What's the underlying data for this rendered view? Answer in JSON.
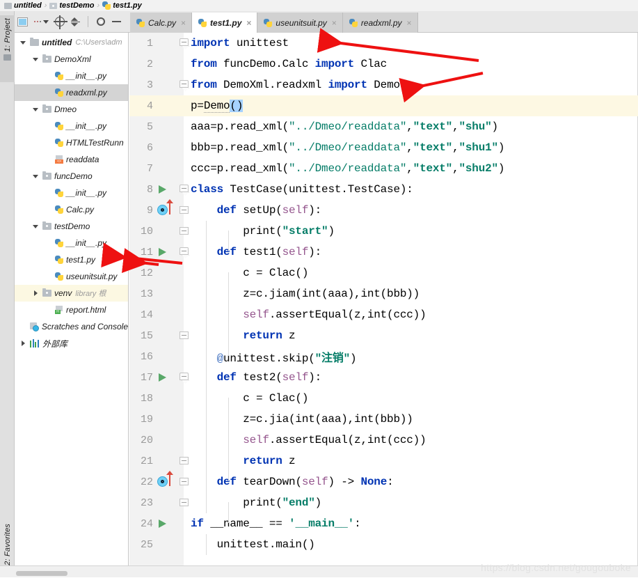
{
  "breadcrumb": {
    "items": [
      {
        "label": "untitled",
        "icon": "folder-icon"
      },
      {
        "label": "testDemo",
        "icon": "module-icon"
      },
      {
        "label": "test1.py",
        "icon": "python-file-icon"
      }
    ],
    "separator": "›"
  },
  "toolbar": {
    "project_view_label": "project-view",
    "dots_label": "show-options",
    "locate_label": "select-opened-file",
    "collapse_label": "collapse-all",
    "settings_label": "settings",
    "hide_label": "hide"
  },
  "stripes": {
    "project_label": "1: Project",
    "favorites_label": "2: Favorites"
  },
  "tabs": [
    {
      "label": "Calc.py",
      "active": false,
      "close": "×"
    },
    {
      "label": "test1.py",
      "active": true,
      "close": "×"
    },
    {
      "label": "useunitsuit.py",
      "active": false,
      "close": "×"
    },
    {
      "label": "readxml.py",
      "active": false,
      "close": "×"
    }
  ],
  "project_tree": [
    {
      "indent": 0,
      "arrow": "down",
      "icon": "folder-icon",
      "label": "untitled",
      "bold": true,
      "sub": "C:\\Users\\adm",
      "state": "normal"
    },
    {
      "indent": 1,
      "arrow": "down",
      "icon": "package-icon",
      "label": "DemoXml",
      "bold": false,
      "sub": "",
      "state": "normal"
    },
    {
      "indent": 2,
      "arrow": "none",
      "icon": "python-file-icon",
      "label": "__init__.py",
      "bold": false,
      "sub": "",
      "state": "normal"
    },
    {
      "indent": 2,
      "arrow": "none",
      "icon": "python-file-icon",
      "label": "readxml.py",
      "bold": false,
      "sub": "",
      "state": "selected"
    },
    {
      "indent": 1,
      "arrow": "down",
      "icon": "package-icon",
      "label": "Dmeo",
      "bold": false,
      "sub": "",
      "state": "normal"
    },
    {
      "indent": 2,
      "arrow": "none",
      "icon": "python-file-icon",
      "label": "__init__.py",
      "bold": false,
      "sub": "",
      "state": "normal"
    },
    {
      "indent": 2,
      "arrow": "none",
      "icon": "python-file-icon",
      "label": "HTMLTestRunn",
      "bold": false,
      "sub": "",
      "state": "normal"
    },
    {
      "indent": 2,
      "arrow": "none",
      "icon": "xml-file-icon",
      "label": "readdata",
      "bold": false,
      "sub": "",
      "state": "normal"
    },
    {
      "indent": 1,
      "arrow": "down",
      "icon": "package-icon",
      "label": "funcDemo",
      "bold": false,
      "sub": "",
      "state": "normal"
    },
    {
      "indent": 2,
      "arrow": "none",
      "icon": "python-file-icon",
      "label": "__init__.py",
      "bold": false,
      "sub": "",
      "state": "normal"
    },
    {
      "indent": 2,
      "arrow": "none",
      "icon": "python-file-icon",
      "label": "Calc.py",
      "bold": false,
      "sub": "",
      "state": "normal"
    },
    {
      "indent": 1,
      "arrow": "down",
      "icon": "package-icon",
      "label": "testDemo",
      "bold": false,
      "sub": "",
      "state": "normal"
    },
    {
      "indent": 2,
      "arrow": "none",
      "icon": "python-file-icon",
      "label": "__init__.py",
      "bold": false,
      "sub": "",
      "state": "normal"
    },
    {
      "indent": 2,
      "arrow": "none",
      "icon": "python-file-icon",
      "label": "test1.py",
      "bold": false,
      "sub": "",
      "state": "normal"
    },
    {
      "indent": 2,
      "arrow": "none",
      "icon": "python-file-icon",
      "label": "useunitsuit.py",
      "bold": false,
      "sub": "",
      "state": "normal"
    },
    {
      "indent": 1,
      "arrow": "right",
      "icon": "package-icon",
      "label": "venv",
      "bold": false,
      "sub": "library 根",
      "state": "highlighted"
    },
    {
      "indent": 2,
      "arrow": "none",
      "icon": "html-file-icon",
      "label": "report.html",
      "bold": false,
      "sub": "",
      "state": "normal"
    },
    {
      "indent": 0,
      "arrow": "none",
      "icon": "scratches-icon",
      "label": "Scratches and Console",
      "bold": false,
      "sub": "",
      "state": "normal"
    },
    {
      "indent": 0,
      "arrow": "right",
      "icon": "library-icon",
      "label": "外部库",
      "bold": false,
      "sub": "",
      "state": "normal"
    }
  ],
  "editor": {
    "active_file": "test1.py",
    "lines": [
      {
        "n": "1",
        "gutter": "fold-top",
        "text": "import unittest"
      },
      {
        "n": "2",
        "gutter": "none",
        "text": "from funcDemo.Calc import Clac"
      },
      {
        "n": "3",
        "gutter": "fold-top",
        "text": "from DemoXml.readxml import Demo"
      },
      {
        "n": "4",
        "gutter": "none",
        "text": "p=Demo()",
        "highlight": true
      },
      {
        "n": "5",
        "gutter": "none",
        "text": "aaa=p.read_xml(\"../Dmeo/readdata\",\"text\",\"shu\")"
      },
      {
        "n": "6",
        "gutter": "none",
        "text": "bbb=p.read_xml(\"../Dmeo/readdata\",\"text\",\"shu1\")"
      },
      {
        "n": "7",
        "gutter": "none",
        "text": "ccc=p.read_xml(\"../Dmeo/readdata\",\"text\",\"shu2\")"
      },
      {
        "n": "8",
        "gutter": "run+fold-top",
        "text": "class TestCase(unittest.TestCase):"
      },
      {
        "n": "9",
        "gutter": "override+fold-mid",
        "text": "    def setUp(self):"
      },
      {
        "n": "10",
        "gutter": "fold-mid",
        "text": "        print(\"start\")"
      },
      {
        "n": "11",
        "gutter": "run+fold-top",
        "text": "    def test1(self):"
      },
      {
        "n": "12",
        "gutter": "none",
        "text": "        c = Clac()"
      },
      {
        "n": "13",
        "gutter": "none",
        "text": "        z=c.jiam(int(aaa),int(bbb))"
      },
      {
        "n": "14",
        "gutter": "none",
        "text": "        self.assertEqual(z,int(ccc))"
      },
      {
        "n": "15",
        "gutter": "fold-mid",
        "text": "        return z"
      },
      {
        "n": "16",
        "gutter": "none",
        "text": "    @unittest.skip(\"注销\")"
      },
      {
        "n": "17",
        "gutter": "run+fold-top",
        "text": "    def test2(self):"
      },
      {
        "n": "18",
        "gutter": "none",
        "text": "        c = Clac()"
      },
      {
        "n": "19",
        "gutter": "none",
        "text": "        z=c.jia(int(aaa),int(bbb))"
      },
      {
        "n": "20",
        "gutter": "none",
        "text": "        self.assertEqual(z,int(ccc))"
      },
      {
        "n": "21",
        "gutter": "fold-mid",
        "text": "        return z"
      },
      {
        "n": "22",
        "gutter": "override+fold-mid",
        "text": "    def tearDown(self) -> None:"
      },
      {
        "n": "23",
        "gutter": "fold-mid",
        "text": "        print(\"end\")"
      },
      {
        "n": "24",
        "gutter": "run",
        "text": "if __name__ == '__main__':"
      },
      {
        "n": "25",
        "gutter": "none",
        "text": "    unittest.main()"
      }
    ]
  },
  "annotations": {
    "arrow_color": "#ee1111",
    "arrows": [
      "arrow-to-import-unittest",
      "arrow-to-import-demo",
      "arrow-to-test1-file",
      "arrow-to-line-11"
    ]
  },
  "watermark": "https://blog.csdn.net/gougouboke",
  "colors": {
    "keyword": "#0033b3",
    "string": "#067d68",
    "self": "#94558d",
    "decorator": "#3f6fbf",
    "run_green": "#59a869",
    "selection": "#a6d2ff",
    "caret_row": "#fdf8e3"
  }
}
